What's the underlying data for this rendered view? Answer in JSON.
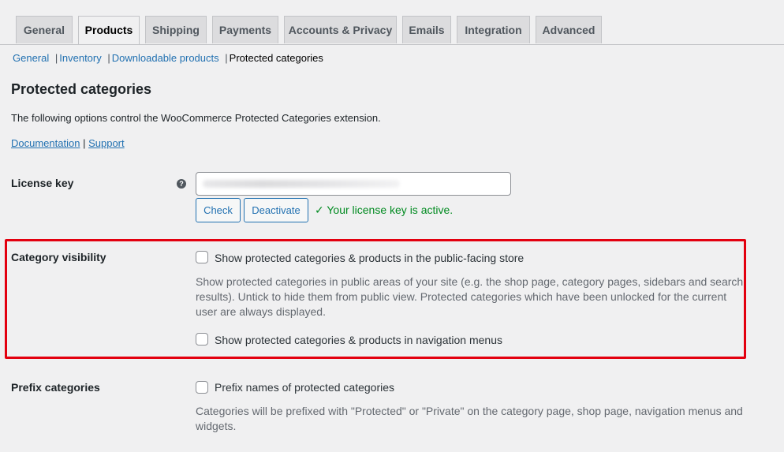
{
  "tabs": [
    {
      "label": "General"
    },
    {
      "label": "Products"
    },
    {
      "label": "Shipping"
    },
    {
      "label": "Payments"
    },
    {
      "label": "Accounts & Privacy"
    },
    {
      "label": "Emails"
    },
    {
      "label": "Integration"
    },
    {
      "label": "Advanced"
    }
  ],
  "active_tab": "Products",
  "subnav": {
    "items": [
      "General",
      "Inventory",
      "Downloadable products"
    ],
    "separator": "|",
    "current": "Protected categories"
  },
  "page": {
    "title": "Protected categories",
    "intro": "The following options control the WooCommerce Protected Categories extension.",
    "doc_link": "Documentation",
    "link_sep": "|",
    "support_link": "Support"
  },
  "license": {
    "label": "License key",
    "help_icon": "question-circle-icon",
    "help_glyph": "?",
    "check_label": "Check",
    "deactivate_label": "Deactivate",
    "status": "✓ Your license key is active.",
    "status_color": "#008a20"
  },
  "category_visibility": {
    "label": "Category visibility",
    "option1_label": "Show protected categories & products in the public-facing store",
    "option1_checked": false,
    "description_lines": [
      "Show protected categories in public areas of your site (e.g. the shop page, category pages, sidebars and search",
      "results). Untick to hide them from public view. Protected categories which have been unlocked for the current",
      "user are always displayed."
    ],
    "option2_label": "Show protected categories & products in navigation menus",
    "option2_checked": false,
    "highlight_color": "#e3000f"
  },
  "prefix": {
    "label": "Prefix categories",
    "option_label": "Prefix names of protected categories",
    "option_checked": false,
    "description_lines": [
      "Categories will be prefixed with \"Protected\" or \"Private\" on the category page, shop page, navigation menus and",
      "widgets."
    ]
  }
}
